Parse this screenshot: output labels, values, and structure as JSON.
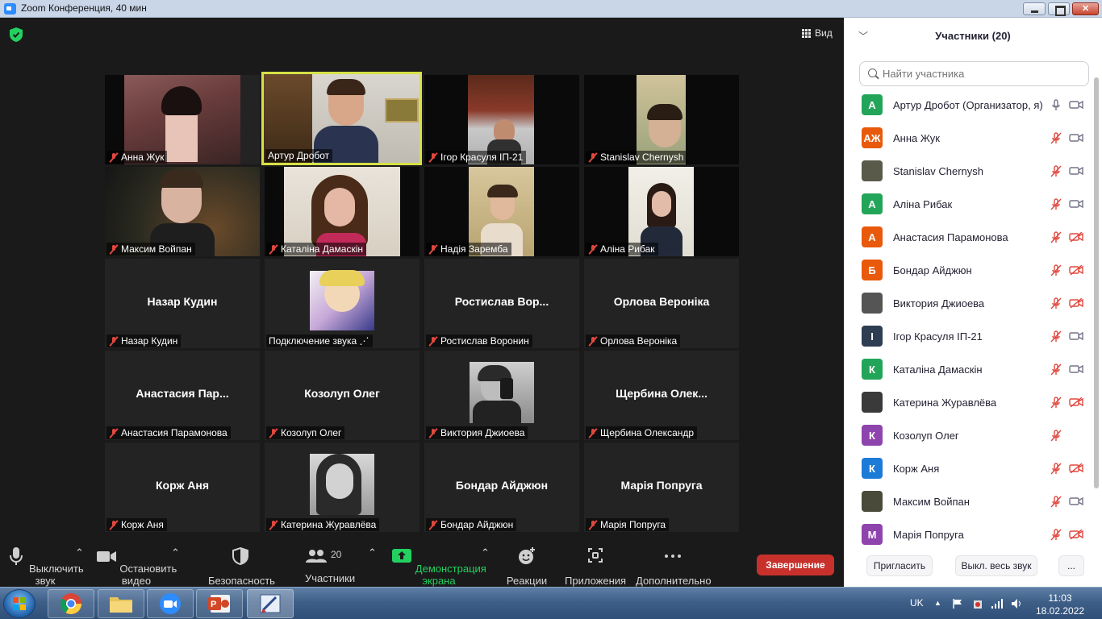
{
  "window": {
    "title": "Zoom Конференция, 40 мин"
  },
  "view_label": "Вид",
  "tiles": [
    {
      "name": "Анна Жук",
      "center": ""
    },
    {
      "name": "Артур Дробот",
      "center": ""
    },
    {
      "name": "Ігор Красуля ІП-21",
      "center": ""
    },
    {
      "name": "Stanislav Chernysh",
      "center": ""
    },
    {
      "name": "Максим Войпан",
      "center": ""
    },
    {
      "name": "Каталіна Дамаскін",
      "center": ""
    },
    {
      "name": "Надія Заремба",
      "center": ""
    },
    {
      "name": "Аліна Рибак",
      "center": ""
    },
    {
      "name": "Назар Кудин",
      "center": "Назар Кудин"
    },
    {
      "name": "Подключение звука ⋰",
      "center": ""
    },
    {
      "name": "Ростислав Воронин",
      "center": "Ростислав  Вор..."
    },
    {
      "name": "Орлова Вероніка",
      "center": "Орлова Вероніка"
    },
    {
      "name": "Анастасия Парамонова",
      "center": "Анастасия  Пар..."
    },
    {
      "name": "Козолуп Олег",
      "center": "Козолуп Олег"
    },
    {
      "name": "Виктория Джиоева",
      "center": ""
    },
    {
      "name": "Щербина Олександр",
      "center": "Щербина  Олек..."
    },
    {
      "name": "Корж Аня",
      "center": "Корж Аня"
    },
    {
      "name": "Катерина Журавлёва",
      "center": ""
    },
    {
      "name": "Бондар Айджюн",
      "center": "Бондар Айджюн"
    },
    {
      "name": "Марія Попруга",
      "center": "Марія Попруга"
    }
  ],
  "toolbar": {
    "mute": "Выключить звук",
    "video": "Остановить видео",
    "security": "Безопасность",
    "participants": "Участники",
    "participants_count": "20",
    "share": "Демонстрация экрана",
    "reactions": "Реакции",
    "apps": "Приложения",
    "more": "Дополнительно",
    "end": "Завершение"
  },
  "panel": {
    "title": "Участники (20)",
    "search_placeholder": "Найти участника",
    "participants": [
      {
        "initials": "А",
        "name": "Артур Дробот (Организатор, я)",
        "color": "#23a559",
        "mic": "on",
        "cam": "on"
      },
      {
        "initials": "АЖ",
        "name": "Анна Жук",
        "color": "#e8590c",
        "mic": "off",
        "cam": "on"
      },
      {
        "initials": "",
        "name": "Stanislav Chernysh",
        "color": "#5a5a4a",
        "mic": "off",
        "cam": "on"
      },
      {
        "initials": "А",
        "name": "Аліна Рибак",
        "color": "#23a559",
        "mic": "off",
        "cam": "on"
      },
      {
        "initials": "А",
        "name": "Анастасия Парамонова",
        "color": "#e8590c",
        "mic": "off",
        "cam": "off"
      },
      {
        "initials": "Б",
        "name": "Бондар Айджюн",
        "color": "#e8590c",
        "mic": "off",
        "cam": "off"
      },
      {
        "initials": "",
        "name": "Виктория Джиоева",
        "color": "#555555",
        "mic": "off",
        "cam": "off"
      },
      {
        "initials": "І",
        "name": "Ігор Красуля ІП-21",
        "color": "#2f3d52",
        "mic": "off",
        "cam": "on"
      },
      {
        "initials": "К",
        "name": "Каталіна Дамаскін",
        "color": "#23a559",
        "mic": "off",
        "cam": "on"
      },
      {
        "initials": "",
        "name": "Катерина Журавлёва",
        "color": "#3a3a3a",
        "mic": "off",
        "cam": "off"
      },
      {
        "initials": "К",
        "name": "Козолуп Олег",
        "color": "#8e44ad",
        "mic": "off",
        "cam": "none"
      },
      {
        "initials": "К",
        "name": "Корж Аня",
        "color": "#1d7bd8",
        "mic": "off",
        "cam": "off"
      },
      {
        "initials": "",
        "name": "Максим Войпан",
        "color": "#4a4a3a",
        "mic": "off",
        "cam": "on"
      },
      {
        "initials": "М",
        "name": "Марія Попруга",
        "color": "#8e44ad",
        "mic": "off",
        "cam": "off"
      }
    ],
    "invite": "Пригласить",
    "mute_all": "Выкл. весь звук",
    "more": "..."
  },
  "taskbar": {
    "lang": "UK",
    "time": "11:03",
    "date": "18.02.2022"
  }
}
